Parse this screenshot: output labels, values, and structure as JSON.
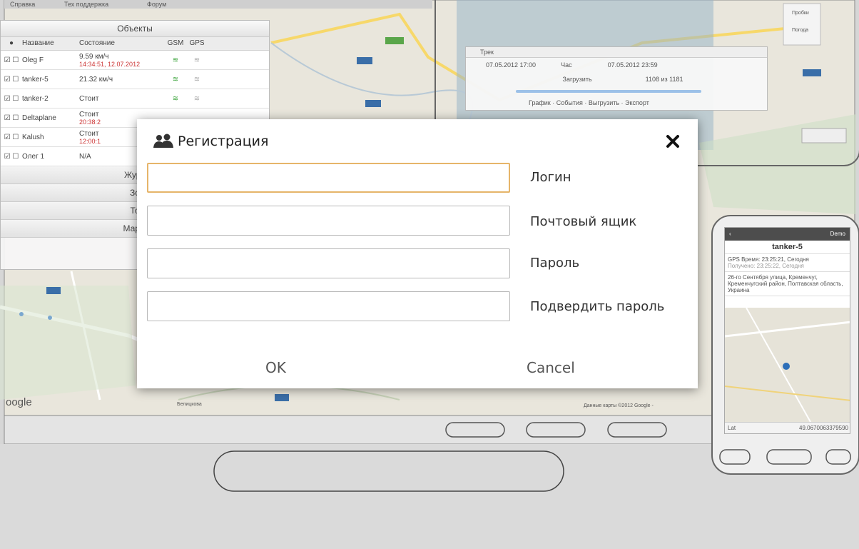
{
  "background": {
    "top_menu": [
      "Справка",
      "Тех поддержка",
      "Форум"
    ],
    "objects_panel": {
      "title": "Объекты",
      "columns": [
        "Название",
        "Состояние",
        "GSM",
        "GPS"
      ],
      "rows": [
        {
          "name": "Oleg F",
          "state": "9.59 км/ч",
          "state2": "14:34:51, 12.07.2012"
        },
        {
          "name": "tanker-5",
          "state": "21.32 км/ч",
          "state2": ""
        },
        {
          "name": "tanker-2",
          "state": "Стоит",
          "state2": ""
        },
        {
          "name": "Deltaplane",
          "state": "Стоит",
          "state2": "20:38:2"
        },
        {
          "name": "Kalush",
          "state": "Стоит",
          "state2": "12:00:1"
        },
        {
          "name": "Олег 1",
          "state": "N/A",
          "state2": ""
        }
      ],
      "accordion": [
        "Журн",
        "Зо",
        "То",
        "Марш"
      ]
    },
    "tracks_panel": {
      "title": "Трек",
      "from": "07.05.2012 17:00",
      "to": "07.05.2012 23:59",
      "step": "Час",
      "upload_label": "Загрузить",
      "range": "1108 из 1181",
      "buttons": [
        "График",
        "События",
        "Выгрузить",
        "Экспорт"
      ]
    },
    "map_copyright": "Данные карты ©2012 Google -",
    "google_logo": "oogle",
    "map_label": "Белицкова",
    "phone": {
      "demo_label": "Demo",
      "object_name": "tanker-5",
      "gps_time": "GPS Время: 23:25:21, Сегодня",
      "received": "Получено: 23:25:22, Сегодня",
      "address": "26-го Сентября улица, Кременчуг, Кременчугский район, Полтавская область, Украина",
      "footer_left": "Lat",
      "footer_right": "49.0670063379590"
    }
  },
  "dialog": {
    "title": "Регистрация",
    "fields": [
      {
        "label": "Логин",
        "value": "",
        "type": "text"
      },
      {
        "label": "Почтовый ящик",
        "value": "",
        "type": "email"
      },
      {
        "label": "Пароль",
        "value": "",
        "type": "password"
      },
      {
        "label": "Подвердить пароль",
        "value": "",
        "type": "password"
      }
    ],
    "ok_label": "OK",
    "cancel_label": "Cancel"
  },
  "icons": {
    "dialog_title": "users-icon",
    "close": "close-icon"
  },
  "colors": {
    "focus_border": "#e6b56a",
    "map": "#ece9e0"
  }
}
